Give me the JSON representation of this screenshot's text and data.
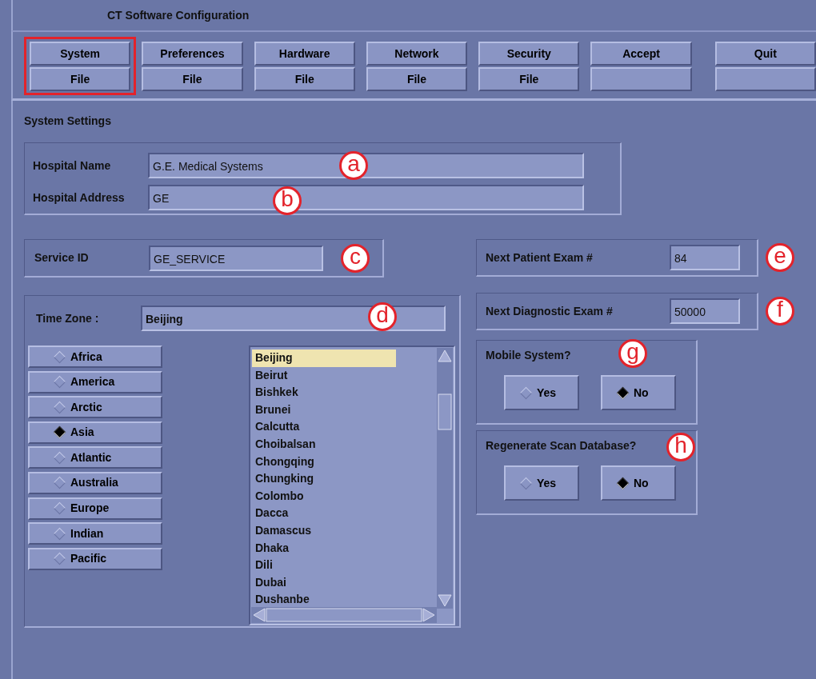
{
  "window": {
    "title": "CT Software Configuration"
  },
  "toolbar": [
    {
      "label": "System",
      "sublabel": "File",
      "highlighted": true
    },
    {
      "label": "Preferences",
      "sublabel": "File",
      "highlighted": false
    },
    {
      "label": "Hardware",
      "sublabel": "File",
      "highlighted": false
    },
    {
      "label": "Network",
      "sublabel": "File",
      "highlighted": false
    },
    {
      "label": "Security",
      "sublabel": "File",
      "highlighted": false
    },
    {
      "label": "Accept",
      "highlighted": false
    },
    {
      "label": "Quit",
      "highlighted": false
    }
  ],
  "section_title": "System Settings",
  "hospital_fields": [
    {
      "label": "Hospital Name",
      "value": "G.E. Medical Systems",
      "callout": "a"
    },
    {
      "label": "Hospital Address",
      "value": "GE",
      "callout": "b"
    }
  ],
  "service_id": {
    "label": "Service ID",
    "value": "GE_SERVICE",
    "callout": "c"
  },
  "time_zone": {
    "label": "Time Zone :",
    "value": "Beijing",
    "callout": "d",
    "regions": [
      {
        "label": "Africa",
        "selected": false
      },
      {
        "label": "America",
        "selected": false
      },
      {
        "label": "Arctic",
        "selected": false
      },
      {
        "label": "Asia",
        "selected": true
      },
      {
        "label": "Atlantic",
        "selected": false
      },
      {
        "label": "Australia",
        "selected": false
      },
      {
        "label": "Europe",
        "selected": false
      },
      {
        "label": "Indian",
        "selected": false
      },
      {
        "label": "Pacific",
        "selected": false
      }
    ],
    "cities": [
      {
        "label": "Beijing",
        "selected": true
      },
      {
        "label": "Beirut",
        "selected": false
      },
      {
        "label": "Bishkek",
        "selected": false
      },
      {
        "label": "Brunei",
        "selected": false
      },
      {
        "label": "Calcutta",
        "selected": false
      },
      {
        "label": "Choibalsan",
        "selected": false
      },
      {
        "label": "Chongqing",
        "selected": false
      },
      {
        "label": "Chungking",
        "selected": false
      },
      {
        "label": "Colombo",
        "selected": false
      },
      {
        "label": "Dacca",
        "selected": false
      },
      {
        "label": "Damascus",
        "selected": false
      },
      {
        "label": "Dhaka",
        "selected": false
      },
      {
        "label": "Dili",
        "selected": false
      },
      {
        "label": "Dubai",
        "selected": false
      },
      {
        "label": "Dushanbe",
        "selected": false
      }
    ]
  },
  "exam_numbers": [
    {
      "label": "Next Patient Exam #",
      "value": "84",
      "callout": "e"
    },
    {
      "label": "Next Diagnostic Exam #",
      "value": "50000",
      "callout": "f"
    }
  ],
  "questions": [
    {
      "label": "Mobile System?",
      "callout": "g",
      "options": [
        {
          "label": "Yes",
          "selected": false
        },
        {
          "label": "No",
          "selected": true
        }
      ]
    },
    {
      "label": "Regenerate Scan Database?",
      "callout": "h",
      "options": [
        {
          "label": "Yes",
          "selected": false
        },
        {
          "label": "No",
          "selected": true
        }
      ]
    }
  ]
}
